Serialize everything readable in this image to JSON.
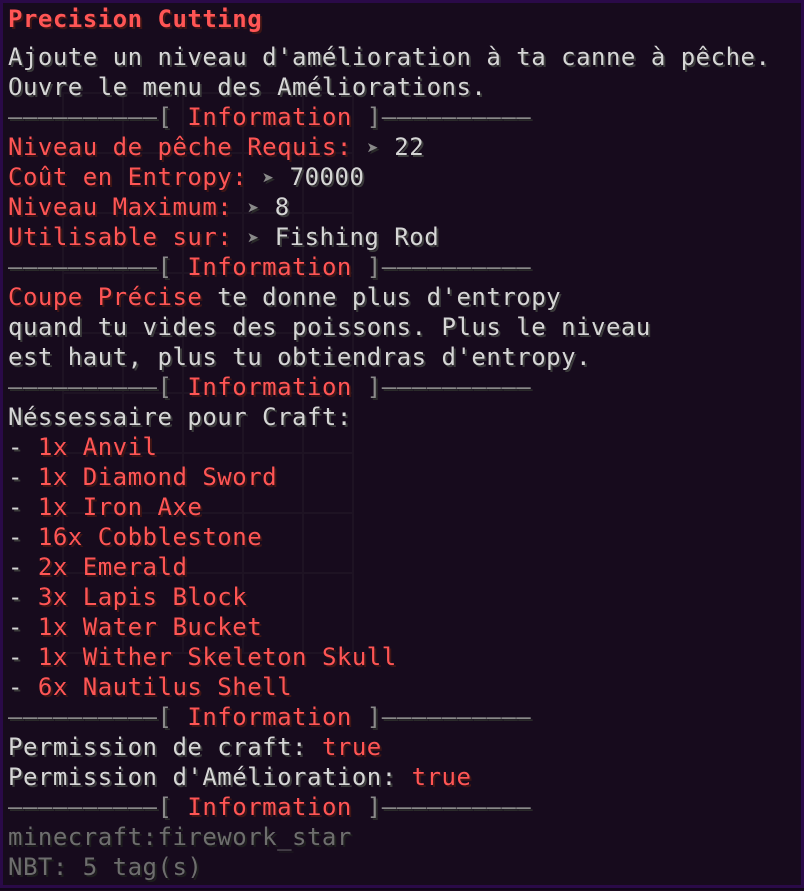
{
  "title": "Precision Cutting",
  "description": [
    "Ajoute un niveau d'amélioration à ta canne à pêche.",
    "Ouvre le menu des Améliorations."
  ],
  "separator": {
    "dashes_left": "——————————[",
    "label": " Information ",
    "dashes_right": "]——————————"
  },
  "stats": [
    {
      "label": "Niveau de pêche Requis:",
      "value": "22"
    },
    {
      "label": "Coût en Entropy:",
      "value": "70000"
    },
    {
      "label": "Niveau Maximum:",
      "value": "8"
    },
    {
      "label": "Utilisable sur:",
      "value": "Fishing Rod"
    }
  ],
  "arrow_glyph": "➤",
  "info_text": {
    "highlight": "Coupe Précise",
    "line1_rest": " te donne plus d'entropy",
    "line2": "quand tu vides des poissons. Plus le niveau",
    "line3": "est haut, plus tu obtiendras d'entropy."
  },
  "craft": {
    "header": "Néssessaire pour Craft:",
    "bullet": "- ",
    "items": [
      "1x Anvil",
      "1x Diamond Sword",
      "1x Iron Axe",
      "16x Cobblestone",
      "2x Emerald",
      "3x Lapis Block",
      "1x Water Bucket",
      "1x Wither Skeleton Skull",
      "6x Nautilus Shell"
    ]
  },
  "permissions": [
    {
      "label": "Permission de craft: ",
      "value": "true"
    },
    {
      "label": "Permission d'Amélioration: ",
      "value": "true"
    }
  ],
  "footer": {
    "item_id": "minecraft:firework_star",
    "nbt": "NBT: 5 tag(s)"
  },
  "colors": {
    "red": "#ff5555",
    "gray": "#d6d6d6",
    "dim": "#6e6e6e",
    "background": "#170b1d",
    "border": "#2a0a48"
  }
}
